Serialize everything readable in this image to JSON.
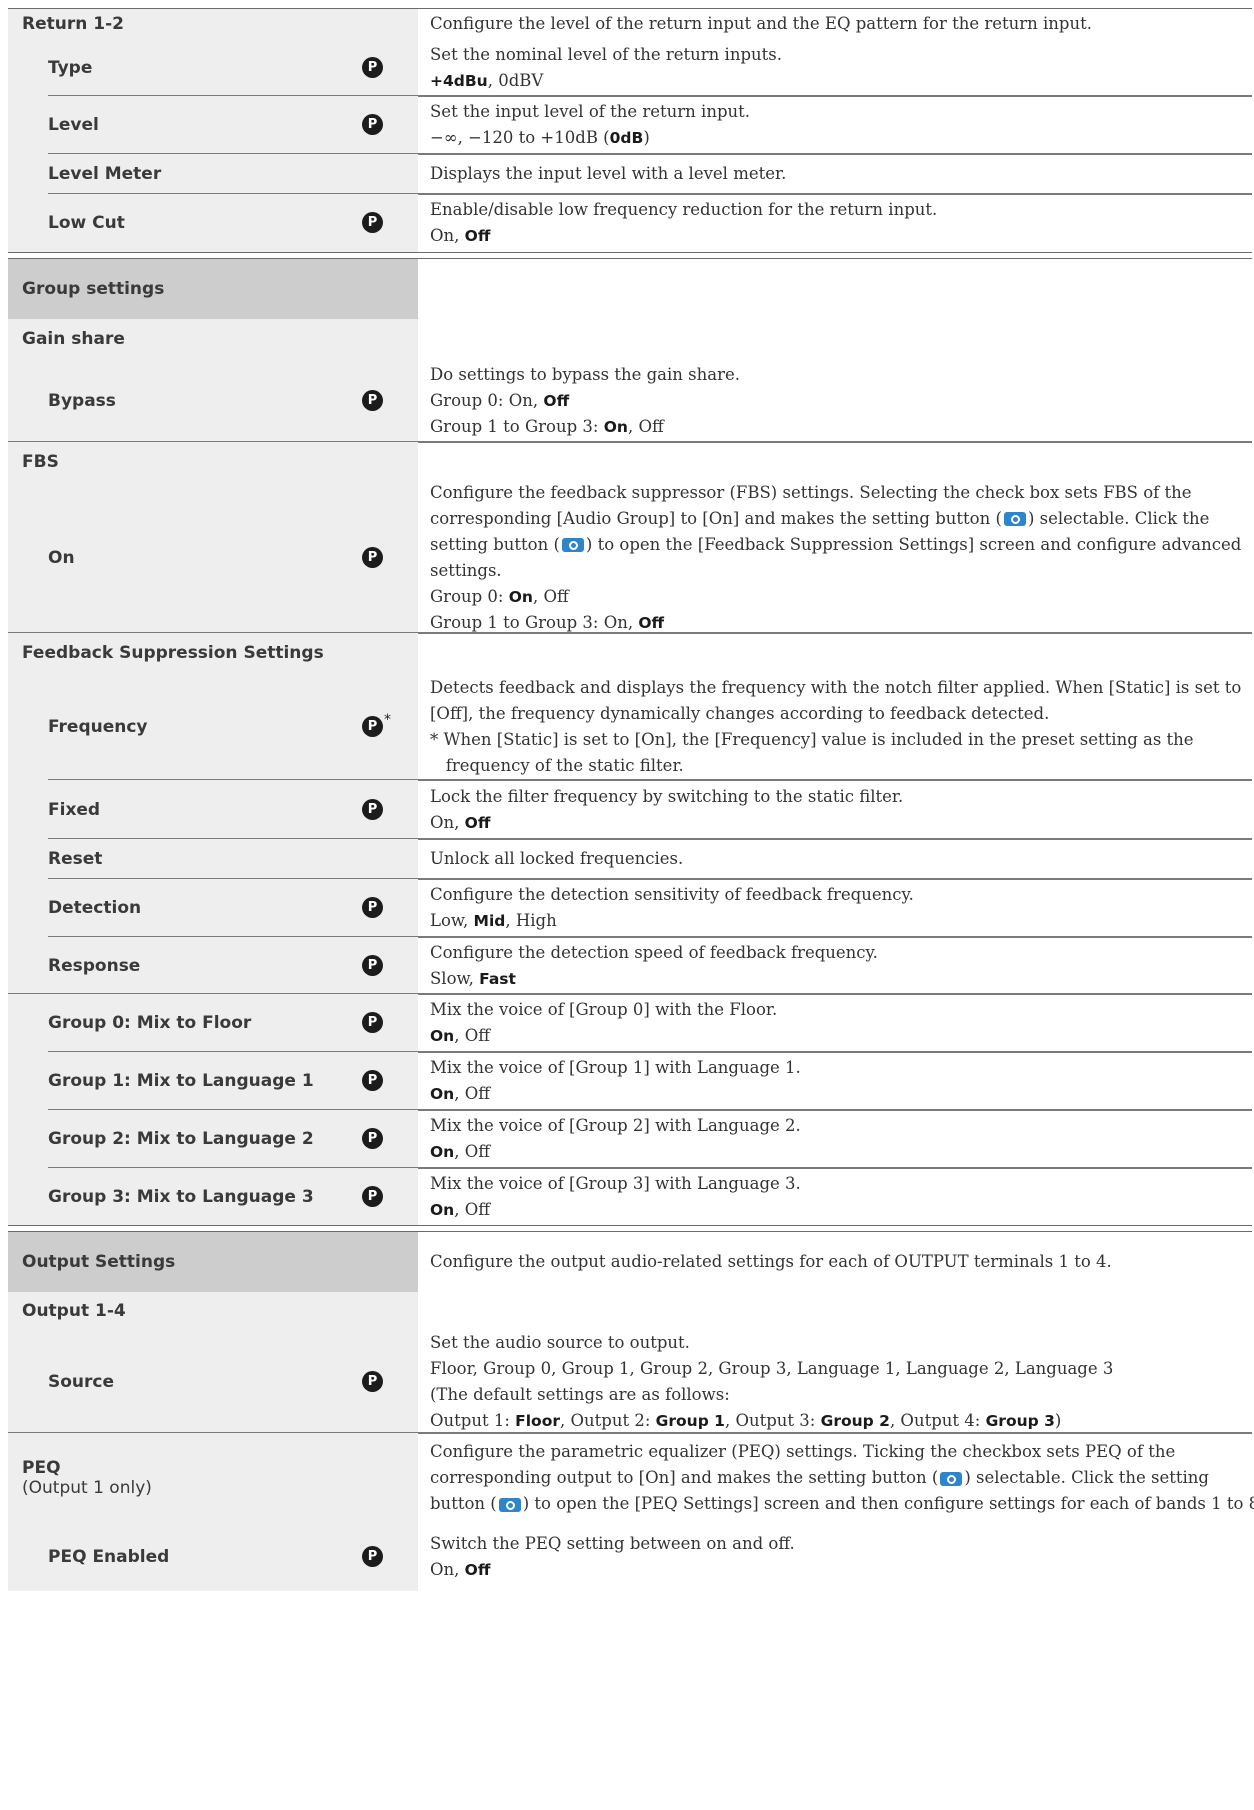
{
  "rows": [
    {
      "id": "r1",
      "label": "Return 1-2",
      "level": 1,
      "badge": false,
      "lines": [
        [
          "Configure the level of the return input and the EQ pattern for the return input."
        ]
      ]
    },
    {
      "id": "r2",
      "label": "Type",
      "level": 2,
      "badge": true,
      "lines": [
        [
          "Set the nominal level of the return inputs."
        ],
        [
          {
            "b": "+4dBu"
          },
          ", 0dBV"
        ]
      ]
    },
    {
      "id": "r3",
      "label": "Level",
      "level": 2,
      "badge": true,
      "lines": [
        [
          "Set the input level of the return input."
        ],
        [
          "−∞, −120 to +10dB (",
          {
            "b": "0dB"
          },
          ")"
        ]
      ]
    },
    {
      "id": "r4",
      "label": "Level Meter",
      "level": 2,
      "badge": false,
      "lines": [
        [
          "Displays the input level with a level meter."
        ]
      ]
    },
    {
      "id": "r5",
      "label": "Low Cut",
      "level": 2,
      "badge": true,
      "lines": [
        [
          "Enable/disable low frequency reduction for the return input."
        ],
        [
          "On, ",
          {
            "b": "Off"
          }
        ]
      ]
    },
    {
      "id": "g1",
      "label": "Group settings",
      "level": 1,
      "section": true,
      "badge": false,
      "lines": []
    },
    {
      "id": "g2",
      "label": "Gain share",
      "level": 1,
      "badge": false,
      "lines": []
    },
    {
      "id": "g3",
      "label": "Bypass",
      "level": 2,
      "badge": true,
      "lines": [
        [
          "Do settings to bypass the gain share."
        ],
        [
          "Group 0: On, ",
          {
            "b": "Off"
          }
        ],
        [
          "Group 1 to Group 3: ",
          {
            "b": "On"
          },
          ", Off"
        ]
      ]
    },
    {
      "id": "f1",
      "label": "FBS",
      "level": 1,
      "badge": false,
      "lines": []
    },
    {
      "id": "f2",
      "label": "On",
      "level": 2,
      "badge": true,
      "lines": [
        [
          "Configure the feedback suppressor (FBS) settings. Selecting the check box sets FBS of the"
        ],
        [
          "corresponding [Audio Group] to [On] and makes the setting button (",
          {
            "icon": "settings-button-icon"
          },
          ") selectable. Click the"
        ],
        [
          "setting button (",
          {
            "icon": "settings-button-icon"
          },
          ") to open the [Feedback Suppression Settings] screen and configure advanced"
        ],
        [
          "settings."
        ],
        [
          "Group 0: ",
          {
            "b": "On"
          },
          ", Off"
        ],
        [
          "Group 1 to Group 3: On, ",
          {
            "b": "Off"
          }
        ]
      ]
    },
    {
      "id": "s1",
      "label": "Feedback Suppression Settings",
      "level": 1,
      "badge": false,
      "lines": []
    },
    {
      "id": "s2",
      "label": "Frequency",
      "level": 2,
      "badge": true,
      "star": true,
      "lines": [
        [
          "Detects feedback and displays the frequency with the notch filter applied. When [Static] is set to"
        ],
        [
          "[Off], the frequency dynamically changes according to feedback detected."
        ],
        [
          "* When [Static] is set to [On], the [Frequency] value is included in the preset setting as the"
        ],
        [
          "   frequency of the static filter."
        ]
      ]
    },
    {
      "id": "s3",
      "label": "Fixed",
      "level": 2,
      "badge": true,
      "lines": [
        [
          "Lock the filter frequency by switching to the static filter."
        ],
        [
          "On, ",
          {
            "b": "Off"
          }
        ]
      ]
    },
    {
      "id": "s4",
      "label": "Reset",
      "level": 2,
      "badge": false,
      "lines": [
        [
          "Unlock all locked frequencies."
        ]
      ]
    },
    {
      "id": "s5",
      "label": "Detection",
      "level": 2,
      "badge": true,
      "lines": [
        [
          "Configure the detection sensitivity of feedback frequency."
        ],
        [
          "Low, ",
          {
            "b": "Mid"
          },
          ", High"
        ]
      ]
    },
    {
      "id": "s6",
      "label": "Response",
      "level": 2,
      "badge": true,
      "lines": [
        [
          "Configure the detection speed of feedback frequency."
        ],
        [
          "Slow, ",
          {
            "b": "Fast"
          }
        ]
      ]
    },
    {
      "id": "m0",
      "label": "Group 0: Mix to Floor",
      "level": 2,
      "badge": true,
      "lines": [
        [
          "Mix the voice of [Group 0] with the Floor."
        ],
        [
          {
            "b": "On"
          },
          ", Off"
        ]
      ]
    },
    {
      "id": "m1",
      "label": "Group 1: Mix to Language 1",
      "level": 2,
      "badge": true,
      "lines": [
        [
          "Mix the voice of [Group 1] with Language 1."
        ],
        [
          {
            "b": "On"
          },
          ", Off"
        ]
      ]
    },
    {
      "id": "m2",
      "label": "Group 2: Mix to Language 2",
      "level": 2,
      "badge": true,
      "lines": [
        [
          "Mix the voice of [Group 2] with Language 2."
        ],
        [
          {
            "b": "On"
          },
          ", Off"
        ]
      ]
    },
    {
      "id": "m3",
      "label": "Group 3: Mix to Language 3",
      "level": 2,
      "badge": true,
      "lines": [
        [
          "Mix the voice of [Group 3] with Language 3."
        ],
        [
          {
            "b": "On"
          },
          ", Off"
        ]
      ]
    },
    {
      "id": "o1",
      "label": "Output Settings",
      "level": 1,
      "section": true,
      "badge": false,
      "lines": [
        [
          "Configure the output audio-related settings for each of OUTPUT terminals 1 to 4."
        ]
      ]
    },
    {
      "id": "o2",
      "label": "Output 1-4",
      "level": 1,
      "badge": false,
      "lines": []
    },
    {
      "id": "o3",
      "label": "Source",
      "level": 2,
      "badge": true,
      "lines": [
        [
          "Set the audio source to output."
        ],
        [
          "Floor, Group 0, Group 1, Group 2, Group 3, Language 1, Language 2, Language 3"
        ],
        [
          "(The default settings are as follows:"
        ],
        [
          "Output 1: ",
          {
            "b": "Floor"
          },
          ", Output 2: ",
          {
            "b": "Group 1"
          },
          ", Output 3: ",
          {
            "b": "Group 2"
          },
          ", Output 4: ",
          {
            "b": "Group 3"
          },
          ")"
        ]
      ]
    },
    {
      "id": "p1",
      "label": "PEQ",
      "sublabel": "(Output 1 only)",
      "level": 1,
      "badge": false,
      "lines": [
        [
          "Configure the parametric equalizer (PEQ) settings. Ticking the checkbox sets PEQ of the"
        ],
        [
          "corresponding output to [On] and makes the setting button (",
          {
            "icon": "settings-button-icon"
          },
          ") selectable. Click the setting"
        ],
        [
          "button (",
          {
            "icon": "settings-button-icon"
          },
          ") to open the [PEQ Settings] screen and then configure settings for each of bands 1 to 8."
        ]
      ]
    },
    {
      "id": "p2",
      "label": "PEQ Enabled",
      "level": 2,
      "badge": true,
      "lines": [
        [
          "Switch the PEQ setting between on and off."
        ],
        [
          "On, ",
          {
            "b": "Off"
          }
        ]
      ]
    }
  ]
}
